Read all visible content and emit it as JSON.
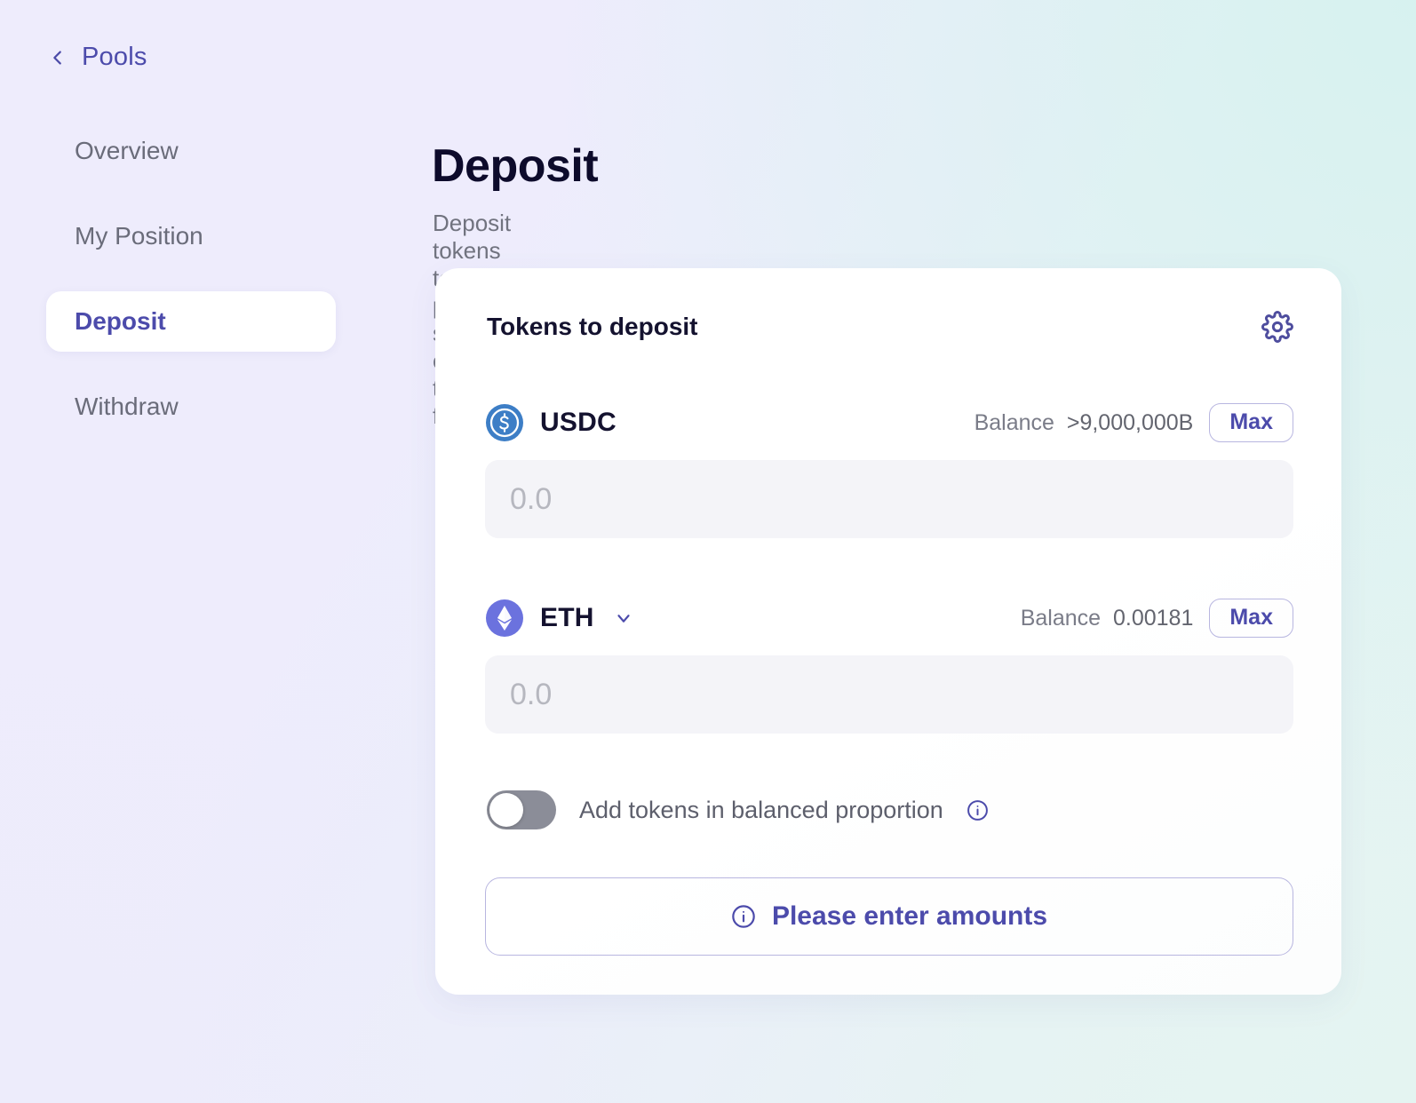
{
  "theme": {
    "accent": "#4c4bab",
    "bg_start": "#eeecfc",
    "bg_end": "#e4f4f1",
    "card_bg": "#ffffff",
    "muted_text": "#71737f",
    "input_bg": "#f4f4f8"
  },
  "sidebar": {
    "back": {
      "label": "Pools",
      "icon": "chevron-left-icon"
    },
    "items": [
      {
        "label": "Overview",
        "active": false
      },
      {
        "label": "My Position",
        "active": false
      },
      {
        "label": "Deposit",
        "active": true
      },
      {
        "label": "Withdraw",
        "active": false
      }
    ]
  },
  "main": {
    "title": "Deposit",
    "subtitle": "Deposit tokens to the pool to start earning trading fees"
  },
  "card": {
    "title": "Tokens to deposit",
    "settings_icon": "gear-icon",
    "tokens": [
      {
        "symbol": "USDC",
        "icon": "usdc-icon",
        "has_selector": false,
        "balance_label": "Balance",
        "balance_value": ">9,000,000B",
        "max_label": "Max",
        "amount_value": "",
        "amount_placeholder": "0.0"
      },
      {
        "symbol": "ETH",
        "icon": "eth-icon",
        "has_selector": true,
        "selector_icon": "chevron-down-icon",
        "balance_label": "Balance",
        "balance_value": "0.00181",
        "max_label": "Max",
        "amount_value": "",
        "amount_placeholder": "0.0"
      }
    ],
    "balanced_toggle": {
      "label": "Add tokens in balanced proportion",
      "checked": false,
      "info_icon": "info-icon"
    },
    "cta": {
      "label": "Please enter amounts",
      "icon": "info-icon",
      "disabled": true
    }
  }
}
